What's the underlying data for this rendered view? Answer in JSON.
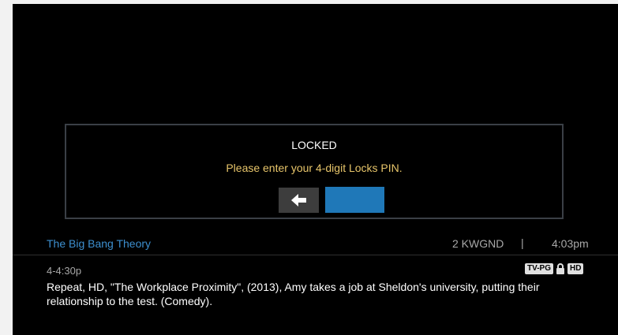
{
  "dialog": {
    "title": "LOCKED",
    "message": "Please enter your 4-digit Locks PIN.",
    "pin_value": ""
  },
  "program": {
    "title": "The Big Bang Theory",
    "channel": "2 KWGND",
    "separator": "|",
    "clock": "4:03pm",
    "time_range": "4-4:30p",
    "rating": "TV-PG",
    "hd": "HD",
    "description": "Repeat, HD, \"The Workplace Proximity\", (2013), Amy takes a job at Sheldon's university, putting their relationship to the test. (Comedy)."
  },
  "icons": {
    "back": "left-arrow-icon",
    "lock": "padlock-icon"
  },
  "colors": {
    "background": "#000000",
    "accent_blue": "#1f78b8",
    "title_blue": "#3d8fcf",
    "message_yellow": "#e7c56a"
  }
}
